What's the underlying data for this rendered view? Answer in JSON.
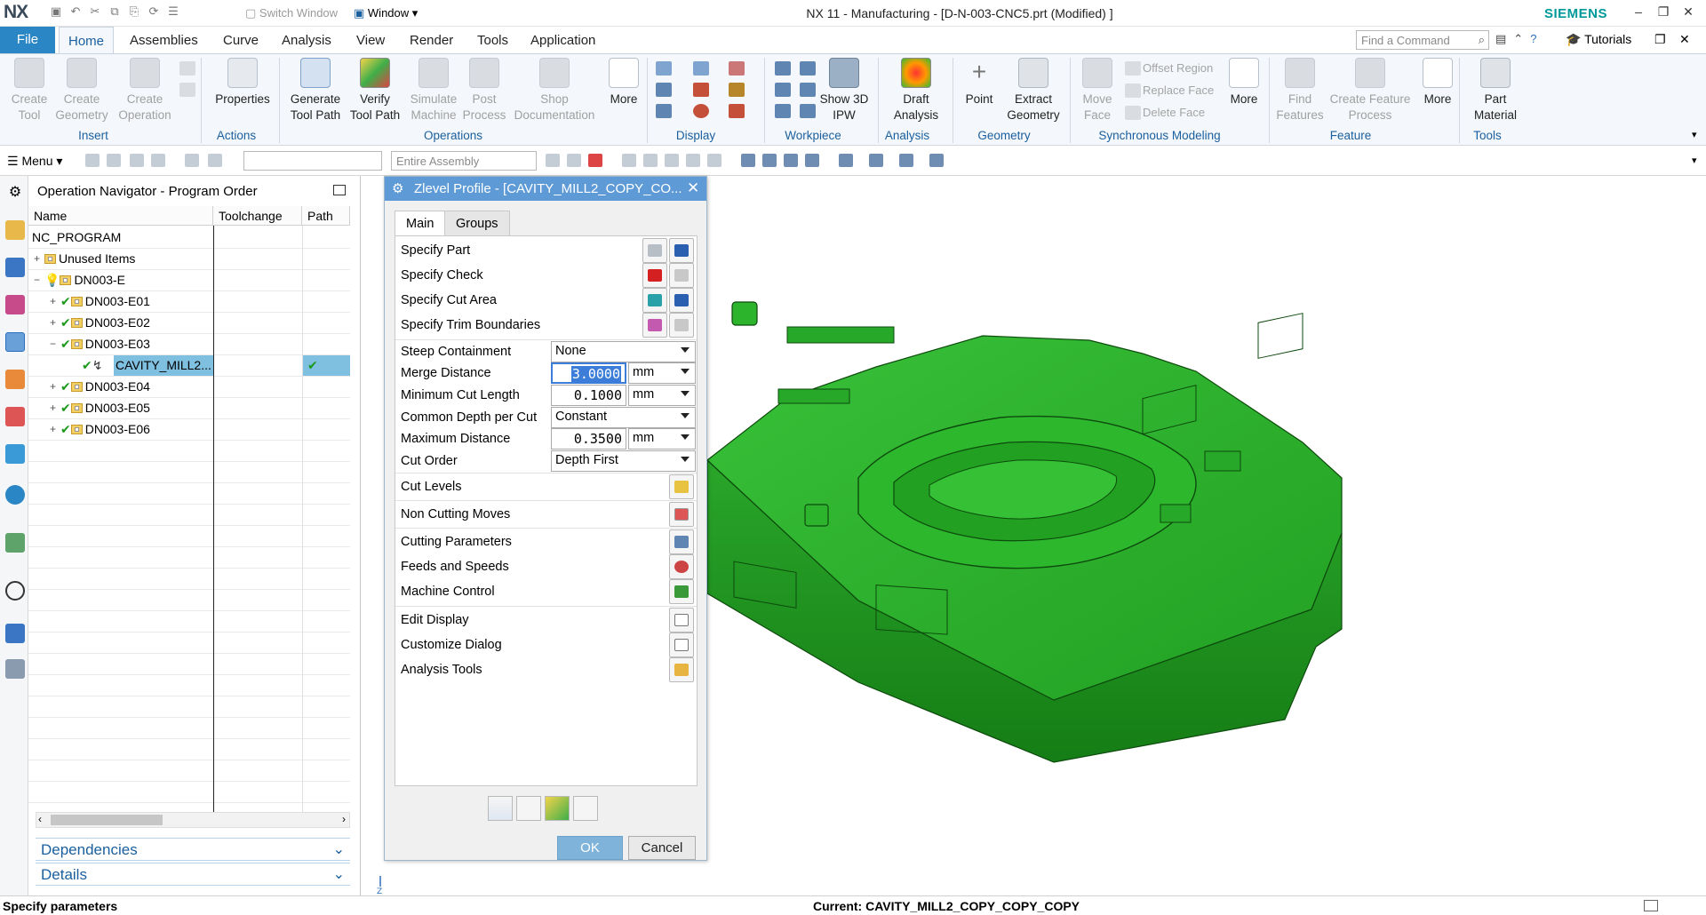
{
  "titlebar": {
    "logo": "NX",
    "switch_window": "Switch Window",
    "window_menu": "Window",
    "title": "NX 11 - Manufacturing - [D-N-003-CNC5.prt (Modified) ]",
    "brand": "SIEMENS"
  },
  "tabs": {
    "file": "File",
    "items": [
      "Home",
      "Assemblies",
      "Curve",
      "Analysis",
      "View",
      "Render",
      "Tools",
      "Application"
    ],
    "find_placeholder": "Find a Command",
    "tutorials": "Tutorials"
  },
  "ribbon": {
    "create_tool": "Create\nTool",
    "create_geometry": "Create\nGeometry",
    "create_operation": "Create\nOperation",
    "properties": "Properties",
    "generate_tool_path": "Generate\nTool Path",
    "verify_tool_path": "Verify\nTool Path",
    "simulate_machine": "Simulate\nMachine",
    "post_process": "Post\nProcess",
    "shop_documentation": "Shop\nDocumentation",
    "more": "More",
    "show_3d_ipw": "Show 3D\nIPW",
    "draft_analysis": "Draft\nAnalysis",
    "point": "Point",
    "extract_geometry": "Extract\nGeometry",
    "move_face": "Move\nFace",
    "offset_region": "Offset Region",
    "replace_face": "Replace Face",
    "delete_face": "Delete Face",
    "find_features": "Find\nFeatures",
    "create_feature_process": "Create Feature\nProcess",
    "part_material": "Part\nMaterial",
    "groups": {
      "insert": "Insert",
      "actions": "Actions",
      "operations": "Operations",
      "display": "Display",
      "workpiece": "Workpiece",
      "analysis": "Analysis",
      "geometry": "Geometry",
      "synchronous_modeling": "Synchronous Modeling",
      "feature": "Feature",
      "tools": "Tools"
    }
  },
  "cmdbar": {
    "menu": "Menu",
    "assembly_filter": "Entire Assembly"
  },
  "navigator": {
    "title": "Operation Navigator - Program Order",
    "columns": [
      "Name",
      "Toolchange",
      "Path"
    ],
    "rows": [
      {
        "name": "NC_PROGRAM"
      },
      {
        "name": "Unused Items"
      },
      {
        "name": "DN003-E"
      },
      {
        "name": "DN003-E01"
      },
      {
        "name": "DN003-E02"
      },
      {
        "name": "DN003-E03"
      },
      {
        "name": "CAVITY_MILL2..."
      },
      {
        "name": "DN003-E04"
      },
      {
        "name": "DN003-E05"
      },
      {
        "name": "DN003-E06"
      }
    ],
    "dependencies": "Dependencies",
    "details": "Details"
  },
  "dialog": {
    "title": "Zlevel Profile - [CAVITY_MILL2_COPY_CO...",
    "tabs": [
      "Main",
      "Groups"
    ],
    "specify_part": "Specify Part",
    "specify_check": "Specify Check",
    "specify_cut_area": "Specify Cut Area",
    "specify_trim_boundaries": "Specify Trim Boundaries",
    "steep_containment": {
      "label": "Steep Containment",
      "value": "None"
    },
    "merge_distance": {
      "label": "Merge Distance",
      "value": "3.0000",
      "unit": "mm"
    },
    "minimum_cut_length": {
      "label": "Minimum Cut Length",
      "value": "0.1000",
      "unit": "mm"
    },
    "common_depth": {
      "label": "Common Depth per Cut",
      "value": "Constant"
    },
    "maximum_distance": {
      "label": "Maximum Distance",
      "value": "0.3500",
      "unit": "mm"
    },
    "cut_order": {
      "label": "Cut Order",
      "value": "Depth First"
    },
    "cut_levels": "Cut Levels",
    "non_cutting_moves": "Non Cutting Moves",
    "cutting_parameters": "Cutting Parameters",
    "feeds_and_speeds": "Feeds and Speeds",
    "machine_control": "Machine Control",
    "edit_display": "Edit Display",
    "customize_dialog": "Customize Dialog",
    "analysis_tools": "Analysis Tools",
    "ok": "OK",
    "cancel": "Cancel"
  },
  "status": {
    "prompt": "Specify parameters",
    "current": "Current: CAVITY_MILL2_COPY_COPY_COPY"
  },
  "colors": {
    "accent": "#2b86c5",
    "dialog_title": "#5d9ad6",
    "part_green": "#2fb52f",
    "brand": "#009999"
  }
}
